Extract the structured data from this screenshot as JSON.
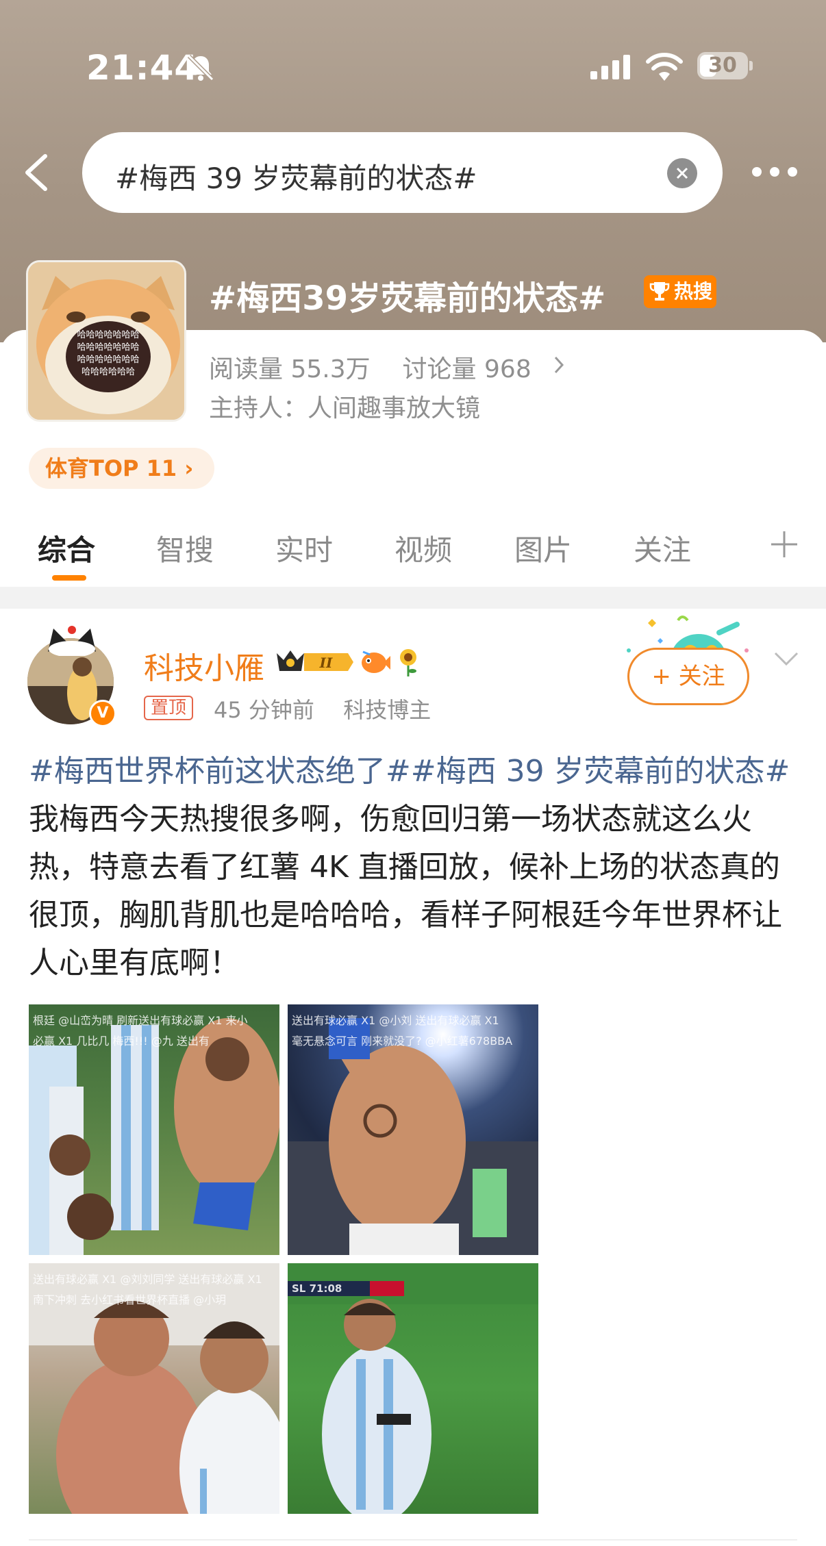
{
  "status_bar": {
    "time": "21:44",
    "battery": "30"
  },
  "search": {
    "query": "#梅西 39 岁荧幕前的状态#"
  },
  "topic": {
    "title": "#梅西39岁荧幕前的状态#",
    "hot_badge": "热搜",
    "reads_label": "阅读量",
    "reads_value": "55.3万",
    "discussions_label": "讨论量",
    "discussions_value": "968",
    "host": "主持人：人间趣事放大镜",
    "rank_tag": "体育TOP 11 ›"
  },
  "tabs": [
    "综合",
    "智搜",
    "实时",
    "视频",
    "图片",
    "关注"
  ],
  "post": {
    "author": "科技小雁",
    "pin_label": "置顶",
    "time": "45 分钟前",
    "author_tag": "科技博主",
    "follow_label": "+ 关注",
    "hashtag1": "#梅西世界杯前这状态绝了#",
    "hashtag2": "#梅西 39 岁荧幕前的状态#",
    "body": "我梅西今天热搜很多啊，伤愈回归第一场状态就这么火热，特意去看了红薯 4K 直播回放，候补上场的状态真的很顶，胸肌背肌也是哈哈哈，看样子阿根廷今年世界杯让人心里有底啊！",
    "images": [
      {
        "caption1": "根廷   @山峦为晴 刷新送出有球必赢 X1    来小",
        "caption2": "必赢 X1        几比几    梅西!!!    @九 送出有"
      },
      {
        "caption1": "送出有球必赢 X1    @小刘 送出有球必赢 X1",
        "caption2": "毫无悬念可言   刚来就没了?    @小红薯678BBA"
      },
      {
        "caption1": "送出有球必赢 X1   @刘刘同学 送出有球必赢 X1",
        "caption2": "南下冲刺    去小红书看世界杯直播    @小玥"
      },
      {
        "caption1": "SL   71:08",
        "caption2": ""
      }
    ]
  },
  "colors": {
    "accent": "#ff8200",
    "name_orange": "#f07d1a",
    "hashtag_blue": "#4a6690"
  },
  "icons": [
    "bell-muted-icon",
    "signal-icon",
    "wifi-icon",
    "battery-icon",
    "back-icon",
    "clear-icon",
    "more-icon",
    "trophy-icon",
    "chevron-right-icon",
    "plus-icon",
    "chevron-down-icon",
    "verified-icon"
  ]
}
